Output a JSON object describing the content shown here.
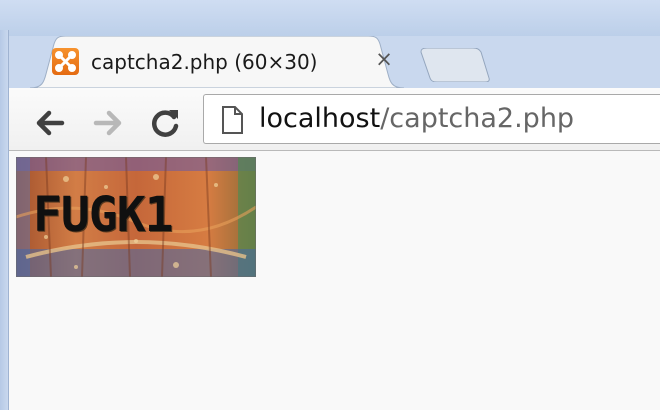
{
  "window": {
    "active_tab": {
      "title": "captcha2.php (60×30)",
      "favicon": "xampp-icon",
      "close_label": "×"
    },
    "new_tab_button": "new-tab-icon"
  },
  "toolbar": {
    "back_icon": "back-arrow-icon",
    "forward_icon": "forward-arrow-icon",
    "reload_icon": "reload-icon",
    "address": {
      "page_icon": "document-icon",
      "host": "localhost",
      "path": "/captcha2.php"
    }
  },
  "page": {
    "captcha_text": "FUGK1"
  },
  "colors": {
    "favicon": "#f07f1f",
    "frame": "#c9d8ee",
    "tab": "#f7f7f7",
    "captcha_bg": "#c46a3a"
  }
}
